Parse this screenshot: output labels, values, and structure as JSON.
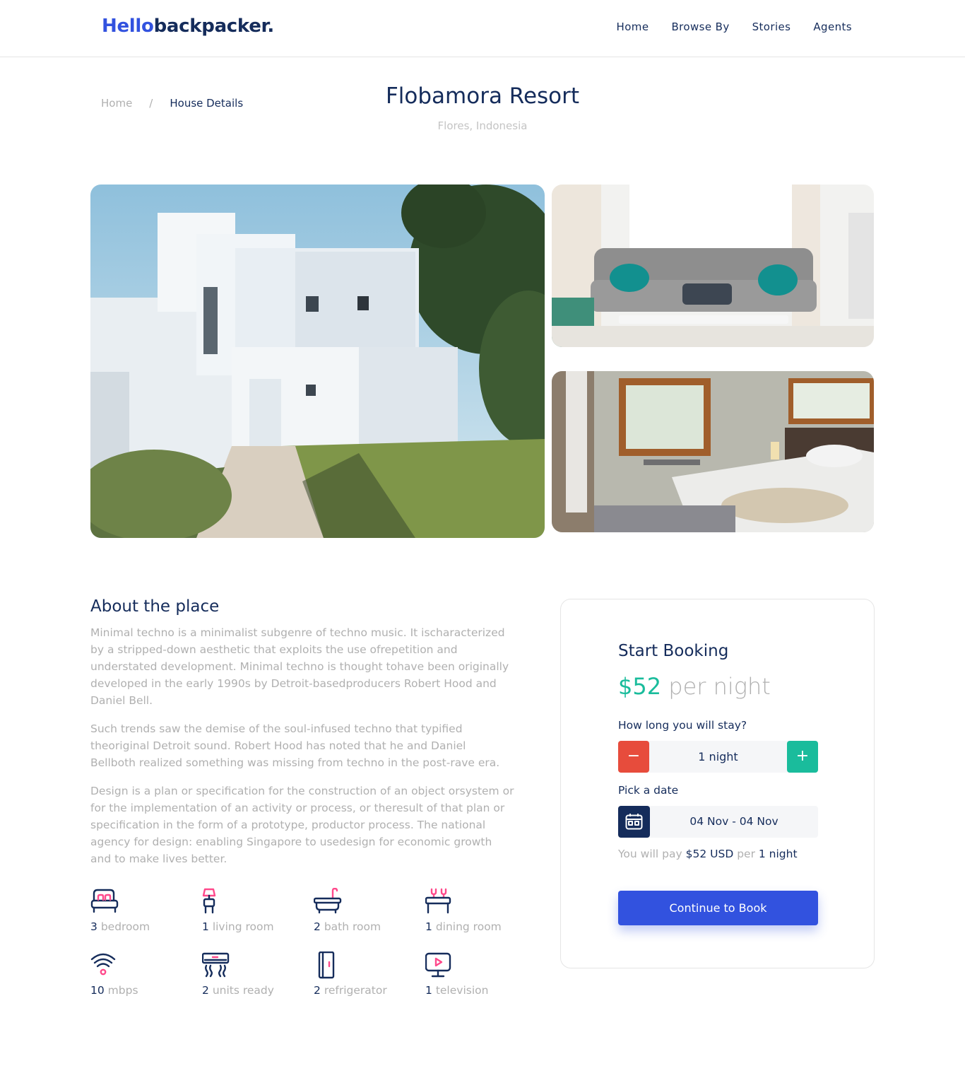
{
  "brand": {
    "part1": "Hello",
    "part2": "backpacker."
  },
  "nav": [
    "Home",
    "Browse By",
    "Stories",
    "Agents"
  ],
  "breadcrumb": {
    "home": "Home",
    "separator": "/",
    "current": "House Details"
  },
  "property": {
    "name": "Flobamora Resort",
    "location": "Flores, Indonesia"
  },
  "gallery": {
    "main": "house-exterior-photo",
    "top": "living-room-photo",
    "bottom": "bedroom-photo"
  },
  "about": {
    "title": "About the place",
    "paragraphs": [
      "Minimal techno is a minimalist subgenre of techno music. It ischaracterized by a stripped-down aesthetic that exploits the use ofrepetition and understated development. Minimal techno is thought tohave been originally developed in the early 1990s by Detroit-basedproducers Robert Hood and Daniel Bell.",
      "Such trends saw the demise of the soul-infused techno that typified theoriginal Detroit sound. Robert Hood has noted that he and Daniel Bellboth realized something was missing from techno in the post-rave era.",
      "Design is a plan or specification for the construction of an object orsystem or for the implementation of an activity or process, or theresult of that plan or specification in the form of a prototype, productor process. The national agency for design: enabling Singapore to usedesign for economic growth and to make lives better."
    ]
  },
  "features": [
    {
      "count": "3",
      "label": "bedroom",
      "icon": "bed-icon"
    },
    {
      "count": "1",
      "label": "living room",
      "icon": "lamp-icon"
    },
    {
      "count": "2",
      "label": "bath room",
      "icon": "bathtub-icon"
    },
    {
      "count": "1",
      "label": "dining room",
      "icon": "dining-table-icon"
    },
    {
      "count": "10",
      "label": "mbps",
      "icon": "wifi-icon"
    },
    {
      "count": "2",
      "label": "units ready",
      "icon": "air-conditioner-icon"
    },
    {
      "count": "2",
      "label": "refrigerator",
      "icon": "refrigerator-icon"
    },
    {
      "count": "1",
      "label": "television",
      "icon": "television-icon"
    }
  ],
  "booking": {
    "title": "Start Booking",
    "price": "$52",
    "per": "per night",
    "duration_label": "How long you will stay?",
    "minus": "−",
    "plus": "+",
    "duration_value": "1 night",
    "date_label": "Pick a date",
    "date_value": "04 Nov - 04 Nov",
    "pay_prefix": "You will pay",
    "pay_amount": "$52 USD",
    "pay_middle": "per",
    "pay_nights": "1 night",
    "cta": "Continue to Book"
  },
  "colors": {
    "primary": "#3252DF",
    "navy": "#152C5B",
    "green": "#1ABC9C",
    "red": "#E74C3C",
    "gray": "#B0B0B0",
    "pink": "#FF498B"
  }
}
